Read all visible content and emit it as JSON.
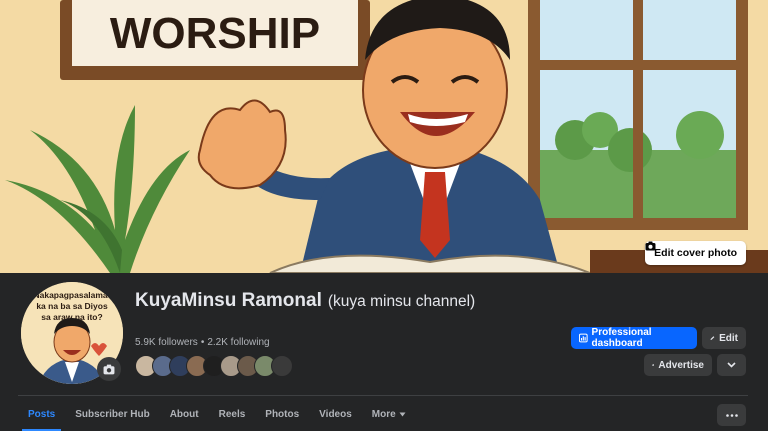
{
  "cover": {
    "sign_text": "WORSHIP",
    "edit_cover_label": "Edit cover photo"
  },
  "avatar": {
    "badge_text_line1": "Nakapagpasalamat",
    "badge_text_line2": "ka na ba sa Diyos",
    "badge_text_line3": "sa araw na ito?"
  },
  "profile": {
    "name": "KuyaMinsu Ramonal",
    "alternate_name": "(kuya minsu channel)",
    "followers": "5.9K followers",
    "separator": "•",
    "following": "2.2K following"
  },
  "actions": {
    "professional_dashboard": "Professional dashboard",
    "edit": "Edit",
    "advertise": "Advertise"
  },
  "tabs": [
    {
      "label": "Posts",
      "active": true
    },
    {
      "label": "Subscriber Hub"
    },
    {
      "label": "About"
    },
    {
      "label": "Reels"
    },
    {
      "label": "Photos"
    },
    {
      "label": "Videos"
    },
    {
      "label": "More"
    }
  ],
  "friend_avatar_colors": [
    "#c9b7a0",
    "#5a6b8c",
    "#2f3e5c",
    "#8a6b52",
    "#1f1f1f",
    "#a89a8a",
    "#6b5a4a",
    "#7a8a6a",
    "#3a3a3a"
  ],
  "colors": {
    "accent": "#0866ff",
    "active_tab": "#2d88ff",
    "panel_bg": "#242526"
  }
}
